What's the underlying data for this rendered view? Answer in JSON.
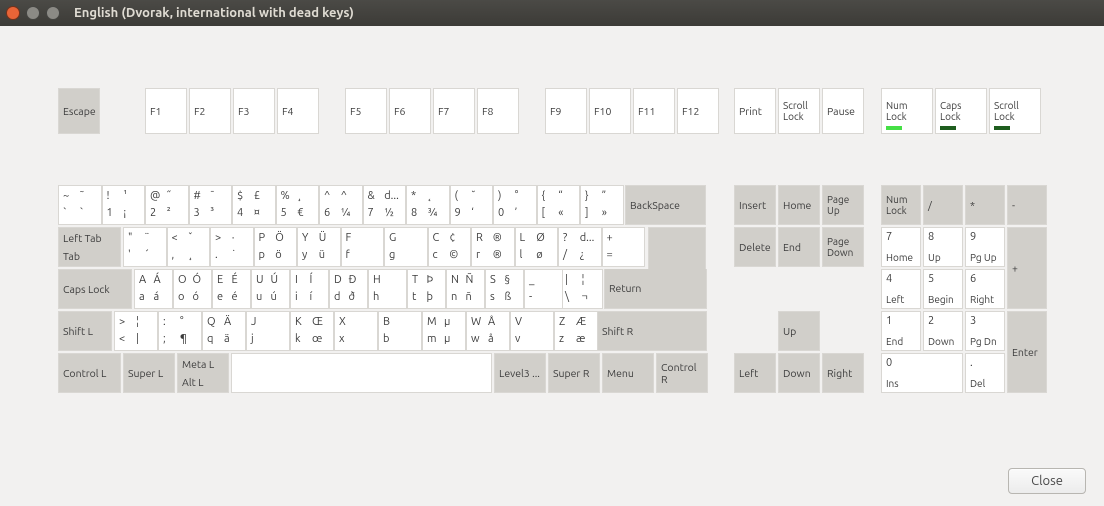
{
  "window": {
    "title": "English (Dvorak, international with dead keys)"
  },
  "buttons": {
    "close": "Close"
  },
  "locks": {
    "num": {
      "label": "Num\nLock",
      "on": true
    },
    "caps": {
      "label": "Caps\nLock",
      "on": false
    },
    "scroll": {
      "label": "Scroll\nLock",
      "on": false
    }
  },
  "special": {
    "escape": "Escape",
    "print": "Print",
    "scrolllock": "Scroll\nLock",
    "pause": "Pause",
    "backspace": "BackSpace",
    "tab_top": "Left Tab",
    "tab_bot": "Tab",
    "return": "Return",
    "capslock": "Caps Lock",
    "shift_l": "Shift L",
    "shift_r": "Shift R",
    "ctrl_l": "Control L",
    "super_l": "Super L",
    "meta_l": "Meta L",
    "alt_l": "Alt L",
    "level3": "Level3 ...",
    "super_r": "Super R",
    "menu": "Menu",
    "ctrl_r": "Control R",
    "insert": "Insert",
    "home": "Home",
    "pgup": "Page\nUp",
    "delete": "Delete",
    "end": "End",
    "pgdn": "Page\nDown",
    "up": "Up",
    "left": "Left",
    "down": "Down",
    "right": "Right",
    "numlock": "Num\nLock",
    "np_div": "/",
    "np_mul": "*",
    "np_sub": "-",
    "np_add": "+",
    "np_enter": "Enter"
  },
  "fkeys": [
    "F1",
    "F2",
    "F3",
    "F4",
    "F5",
    "F6",
    "F7",
    "F8",
    "F9",
    "F10",
    "F11",
    "F12"
  ],
  "row1": [
    {
      "tl": "~",
      "tr": "˜",
      "bl": "`",
      "br": "`"
    },
    {
      "tl": "!",
      "tr": "¹",
      "bl": "1",
      "br": "¡"
    },
    {
      "tl": "@",
      "tr": "˝",
      "bl": "2",
      "br": "²"
    },
    {
      "tl": "#",
      "tr": "¯",
      "bl": "3",
      "br": "³"
    },
    {
      "tl": "$",
      "tr": "£",
      "bl": "4",
      "br": "¤"
    },
    {
      "tl": "%",
      "tr": "¸",
      "bl": "5",
      "br": "€"
    },
    {
      "tl": "^",
      "tr": "^",
      "bl": "6",
      "br": "¼"
    },
    {
      "tl": "&",
      "tr": "d...",
      "bl": "7",
      "br": "½"
    },
    {
      "tl": "*",
      "tr": "˛",
      "bl": "8",
      "br": "¾"
    },
    {
      "tl": "(",
      "tr": "˘",
      "bl": "9",
      "br": "‘"
    },
    {
      "tl": ")",
      "tr": "°",
      "bl": "0",
      "br": "’"
    },
    {
      "tl": "{",
      "tr": "“",
      "bl": "[",
      "br": "«"
    },
    {
      "tl": "}",
      "tr": "”",
      "bl": "]",
      "br": "»"
    }
  ],
  "row2": [
    {
      "tl": "\"",
      "tr": "¨",
      "bl": "'",
      "br": "´"
    },
    {
      "tl": "<",
      "tr": "ˇ",
      "bl": ",",
      "br": "¸"
    },
    {
      "tl": ">",
      "tr": "·",
      "bl": ".",
      "br": "˙"
    },
    {
      "tl": "P",
      "tr": "Ö",
      "bl": "p",
      "br": "ö"
    },
    {
      "tl": "Y",
      "tr": "Ü",
      "bl": "y",
      "br": "ü"
    },
    {
      "tl": "F",
      "tr": "",
      "bl": "f",
      "br": ""
    },
    {
      "tl": "G",
      "tr": "",
      "bl": "g",
      "br": ""
    },
    {
      "tl": "C",
      "tr": "¢",
      "bl": "c",
      "br": "©"
    },
    {
      "tl": "R",
      "tr": "®",
      "bl": "r",
      "br": "®"
    },
    {
      "tl": "L",
      "tr": "Ø",
      "bl": "l",
      "br": "ø"
    },
    {
      "tl": "?",
      "tr": "d...",
      "bl": "/",
      "br": "¿"
    },
    {
      "tl": "+",
      "tr": "",
      "bl": "=",
      "br": ""
    },
    {
      "tl": "|",
      "tr": "¦",
      "bl": "\\",
      "br": "¬"
    }
  ],
  "row3": [
    {
      "tl": "A",
      "tr": "Á",
      "bl": "a",
      "br": "á"
    },
    {
      "tl": "O",
      "tr": "Ó",
      "bl": "o",
      "br": "ó"
    },
    {
      "tl": "E",
      "tr": "É",
      "bl": "e",
      "br": "é"
    },
    {
      "tl": "U",
      "tr": "Ú",
      "bl": "u",
      "br": "ú"
    },
    {
      "tl": "I",
      "tr": "Í",
      "bl": "i",
      "br": "í"
    },
    {
      "tl": "D",
      "tr": "Ð",
      "bl": "d",
      "br": "ð"
    },
    {
      "tl": "H",
      "tr": "",
      "bl": "h",
      "br": ""
    },
    {
      "tl": "T",
      "tr": "Þ",
      "bl": "t",
      "br": "þ"
    },
    {
      "tl": "N",
      "tr": "Ñ",
      "bl": "n",
      "br": "ñ"
    },
    {
      "tl": "S",
      "tr": "§",
      "bl": "s",
      "br": "ß"
    },
    {
      "tl": "_",
      "tr": "",
      "bl": "-",
      "br": ""
    }
  ],
  "row4": [
    {
      "tl": ">",
      "tr": "¦",
      "bl": "<",
      "br": "|"
    },
    {
      "tl": ":",
      "tr": "°",
      "bl": ";",
      "br": "¶"
    },
    {
      "tl": "Q",
      "tr": "Ä",
      "bl": "q",
      "br": "ä"
    },
    {
      "tl": "J",
      "tr": "",
      "bl": "j",
      "br": ""
    },
    {
      "tl": "K",
      "tr": "Œ",
      "bl": "k",
      "br": "œ"
    },
    {
      "tl": "X",
      "tr": "",
      "bl": "x",
      "br": ""
    },
    {
      "tl": "B",
      "tr": "",
      "bl": "b",
      "br": ""
    },
    {
      "tl": "M",
      "tr": "µ",
      "bl": "m",
      "br": "µ"
    },
    {
      "tl": "W",
      "tr": "Å",
      "bl": "w",
      "br": "å"
    },
    {
      "tl": "V",
      "tr": "",
      "bl": "v",
      "br": ""
    },
    {
      "tl": "Z",
      "tr": "Æ",
      "bl": "z",
      "br": "æ"
    }
  ],
  "numpad": [
    {
      "main": "7",
      "sub": "Home"
    },
    {
      "main": "8",
      "sub": "Up"
    },
    {
      "main": "9",
      "sub": "Pg Up"
    },
    {
      "main": "4",
      "sub": "Left"
    },
    {
      "main": "5",
      "sub": "Begin"
    },
    {
      "main": "6",
      "sub": "Right"
    },
    {
      "main": "1",
      "sub": "End"
    },
    {
      "main": "2",
      "sub": "Down"
    },
    {
      "main": "3",
      "sub": "Pg Dn"
    },
    {
      "main": "0",
      "sub": "Ins"
    },
    {
      "main": ".",
      "sub": "Del"
    }
  ]
}
